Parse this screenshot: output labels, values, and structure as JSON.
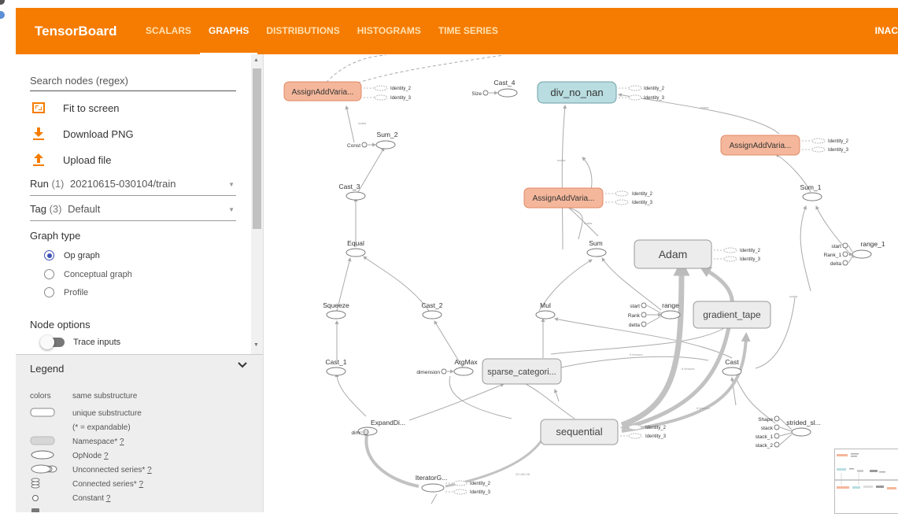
{
  "app": {
    "brand": "TensorBoard",
    "tabs": [
      {
        "label": "SCALARS",
        "active": false
      },
      {
        "label": "GRAPHS",
        "active": true
      },
      {
        "label": "DISTRIBUTIONS",
        "active": false
      },
      {
        "label": "HISTOGRAMS",
        "active": false
      },
      {
        "label": "TIME SERIES",
        "active": false
      }
    ],
    "inactive_label": "INAC",
    "colors": {
      "accent": "#f57c00",
      "radio": "#3f51b5",
      "node_orange": "#f4b79b",
      "node_teal": "#b9dde0",
      "node_gray": "#ececec"
    }
  },
  "sidebar": {
    "search_placeholder": "Search nodes (regex)",
    "actions": [
      {
        "label": "Fit to screen",
        "icon": "fit-screen-icon"
      },
      {
        "label": "Download PNG",
        "icon": "download-icon"
      },
      {
        "label": "Upload file",
        "icon": "upload-icon"
      }
    ],
    "run": {
      "label": "Run",
      "count": "(1)",
      "value": "20210615-030104/train"
    },
    "tag": {
      "label": "Tag",
      "count": "(3)",
      "value": "Default"
    },
    "graph_type": {
      "label": "Graph type",
      "options": [
        {
          "label": "Op graph",
          "selected": true
        },
        {
          "label": "Conceptual graph",
          "selected": false
        },
        {
          "label": "Profile",
          "selected": false
        }
      ]
    },
    "node_options": {
      "label": "Node options",
      "trace_inputs": "Trace inputs",
      "trace_on": false
    }
  },
  "legend": {
    "title": "Legend",
    "colors_label": "colors",
    "colors_desc": "same substructure",
    "items": [
      {
        "label": "unique substructure"
      },
      {
        "label": "(* = expandable)"
      },
      {
        "label": "Namespace*",
        "help": "?"
      },
      {
        "label": "OpNode",
        "help": "?"
      },
      {
        "label": "Unconnected series*",
        "help": "?"
      },
      {
        "label": "Connected series*",
        "help": "?"
      },
      {
        "label": "Constant",
        "help": "?"
      }
    ]
  },
  "graph": {
    "meta_nodes": [
      {
        "label": "AssignAddVaria...",
        "color": "orange"
      },
      {
        "label": "div_no_nan",
        "color": "teal"
      },
      {
        "label": "AssignAddVaria...",
        "color": "orange"
      },
      {
        "label": "AssignAddVaria...",
        "color": "orange"
      },
      {
        "label": "Adam",
        "color": "gray"
      },
      {
        "label": "gradient_tape",
        "color": "gray"
      },
      {
        "label": "sparse_categori...",
        "color": "gray"
      },
      {
        "label": "sequential",
        "color": "gray"
      }
    ],
    "op_labels": {
      "cast4": "Cast_4",
      "size": "Size",
      "sum2": "Sum_2",
      "const": "Const",
      "cast3": "Cast_3",
      "equal": "Equal",
      "squeeze": "Squeeze",
      "cast2": "Cast_2",
      "cast1": "Cast_1",
      "argmax": "ArgMax",
      "dimension": "dimension",
      "expanddi": "ExpandDi...",
      "dim": "dim",
      "iterator": "IteratorG...",
      "sum": "Sum",
      "mul": "Mul",
      "range": "range",
      "start": "start",
      "rank": "Rank",
      "delta": "delta",
      "sum1": "Sum_1",
      "range1": "range_1",
      "start1": "start",
      "rank1": "Rank_1",
      "delta1": "delta",
      "cast": "Cast",
      "shape": "Shape",
      "stack": "stack",
      "stack1": "stack_1",
      "stack2": "stack_2",
      "strided": "strided_sl..."
    },
    "aux": {
      "identity2": "Identity_2",
      "identity3": "Identity_3"
    }
  }
}
